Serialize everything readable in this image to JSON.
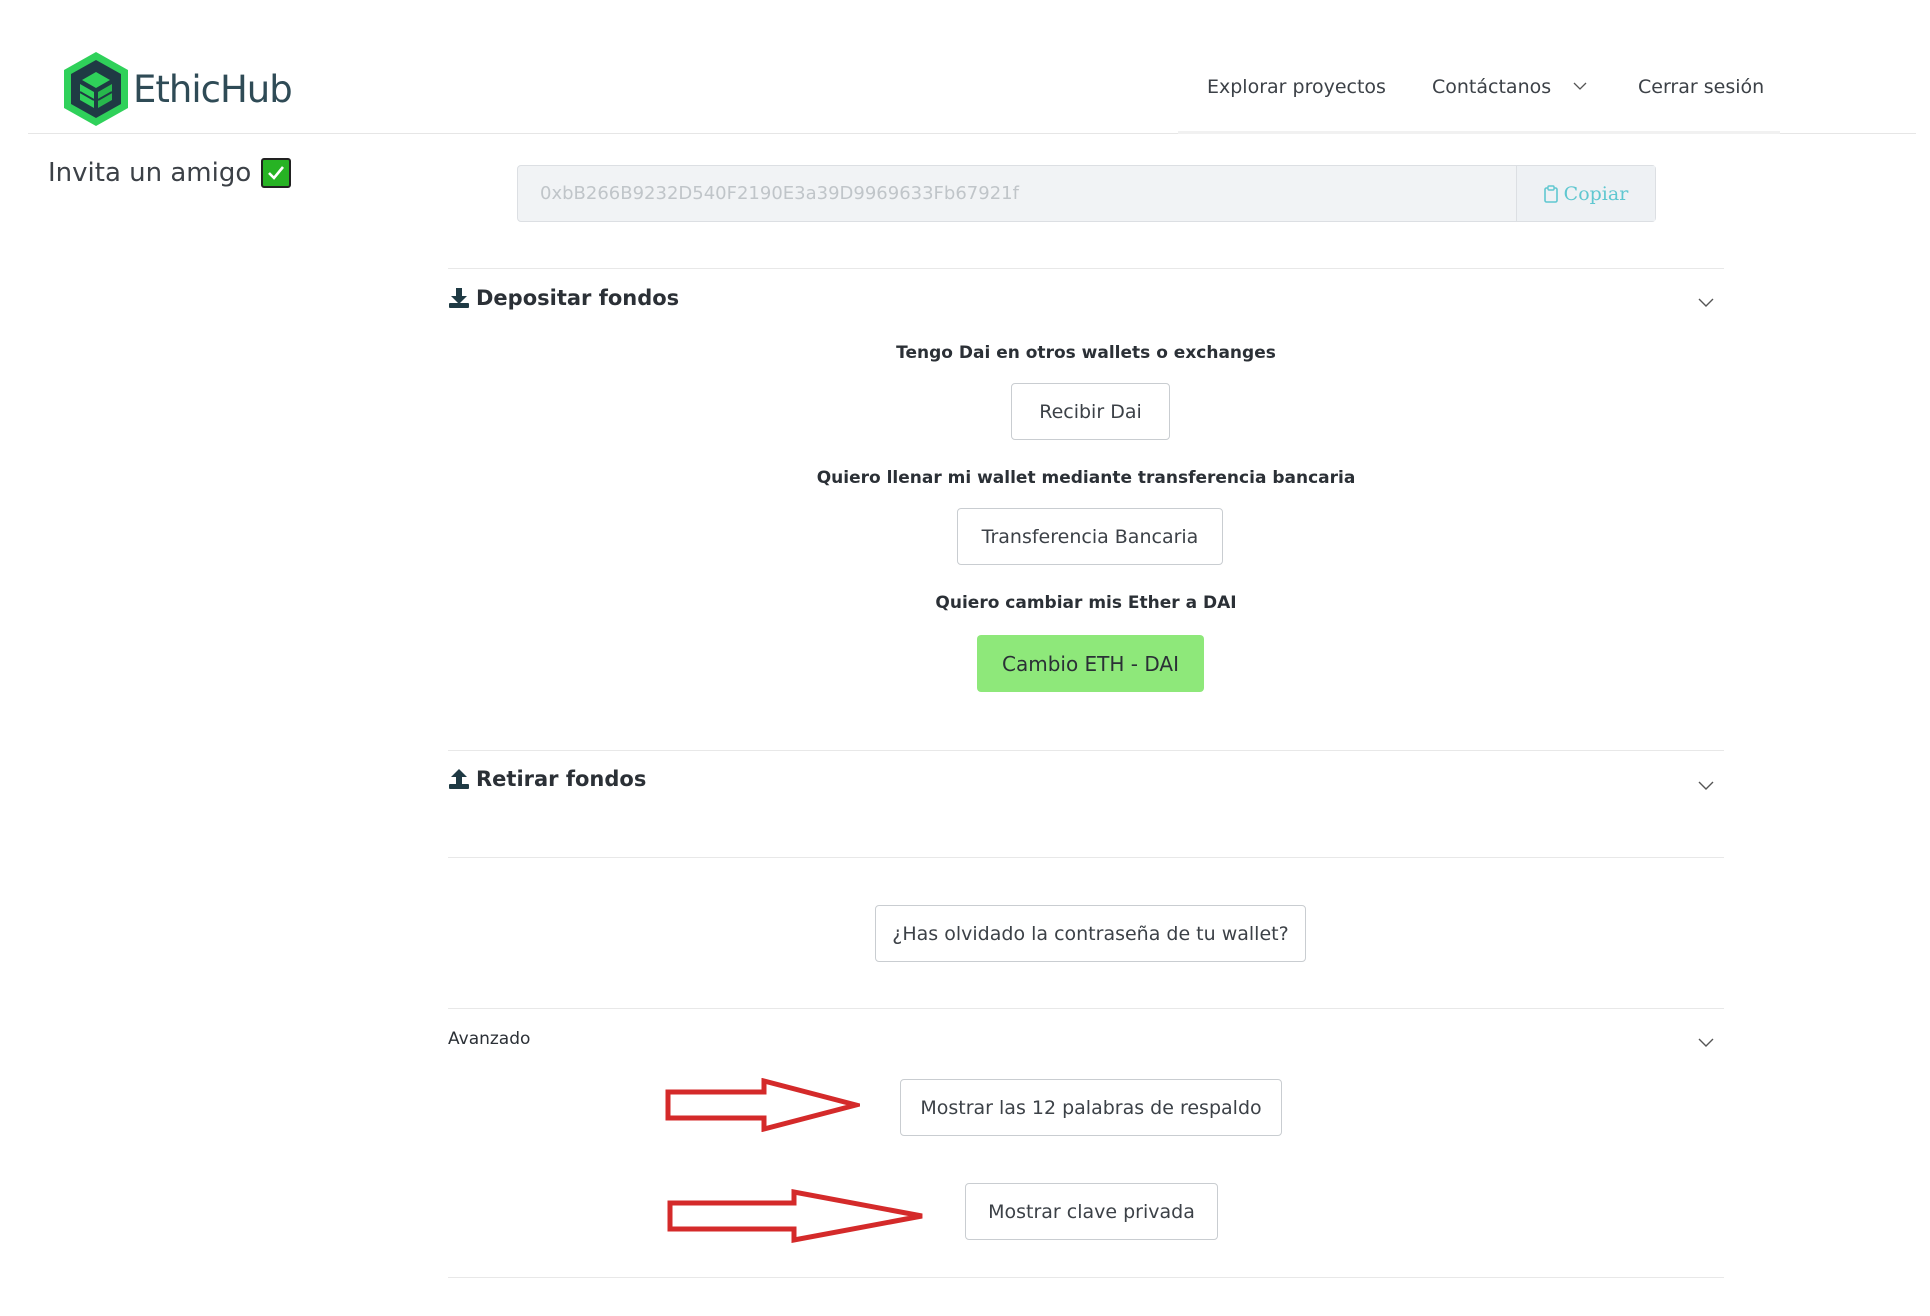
{
  "header": {
    "brand": "EthicHub",
    "nav": {
      "explore": "Explorar proyectos",
      "contact": "Contáctanos",
      "logout": "Cerrar sesión"
    }
  },
  "sidebar": {
    "invite": "Invita un amigo"
  },
  "wallet": {
    "address": "0xbB266B9232D540F2190E3a39D9969633Fb67921f",
    "copy_label": "Copiar"
  },
  "deposit": {
    "title": "Depositar fondos",
    "options": [
      {
        "caption": "Tengo Dai en otros wallets o exchanges",
        "button": "Recibir Dai"
      },
      {
        "caption": "Quiero llenar mi wallet mediante transferencia bancaria",
        "button": "Transferencia Bancaria"
      },
      {
        "caption": "Quiero cambiar mis Ether a DAI",
        "button": "Cambio ETH - DAI"
      }
    ]
  },
  "withdraw": {
    "title": "Retirar fondos"
  },
  "forgot": {
    "button": "¿Has olvidado la contraseña de tu wallet?"
  },
  "advanced": {
    "title": "Avanzado",
    "show_words": "Mostrar las 12 palabras de respaldo",
    "show_key": "Mostrar clave privada"
  },
  "colors": {
    "brand_green": "#2fbf4a",
    "accent_button": "#8ee87a",
    "copy_text": "#5fc7d0",
    "annotation_arrow": "#d42a2a"
  }
}
